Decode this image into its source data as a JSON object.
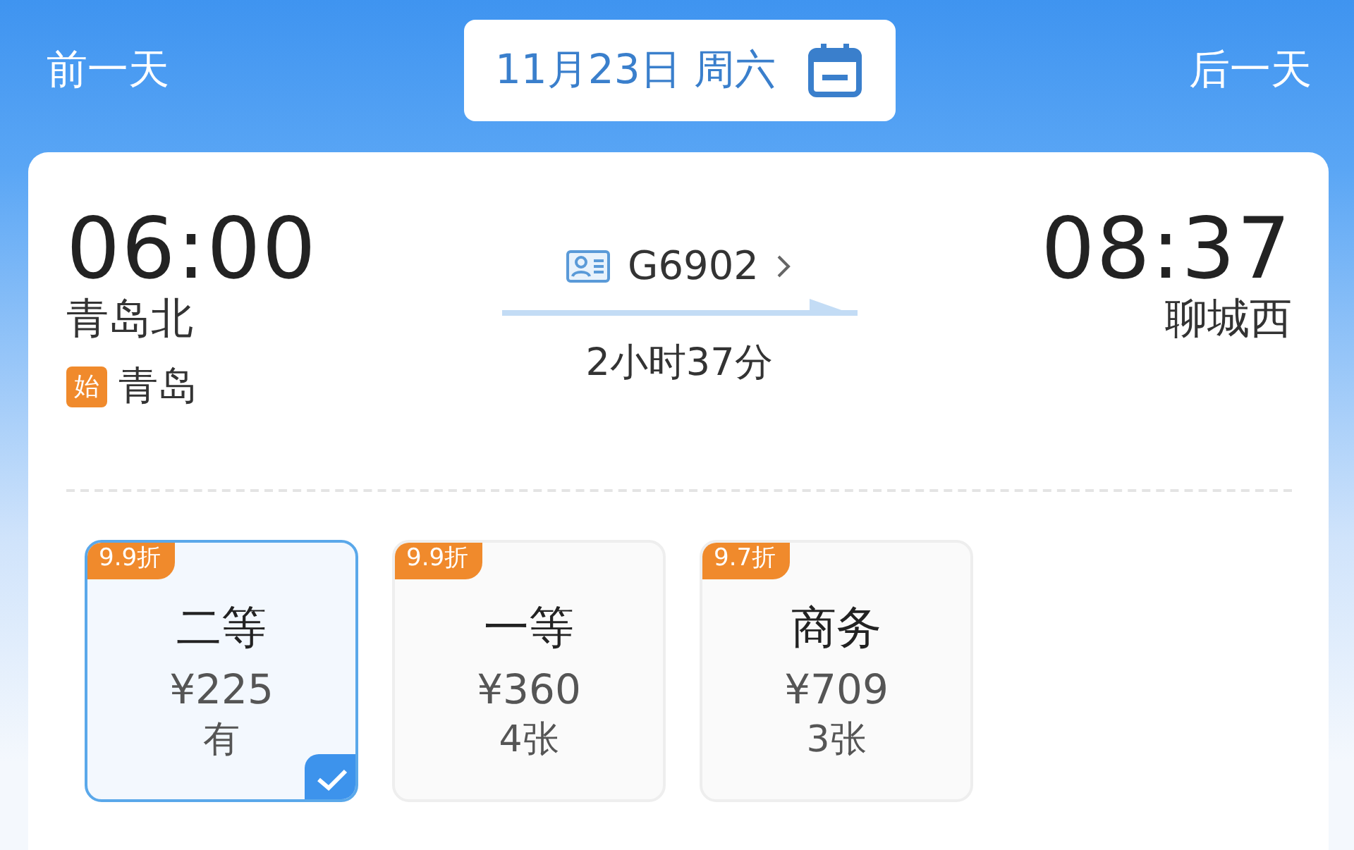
{
  "header": {
    "prev_day": "前一天",
    "date": "11月23日 周六",
    "next_day": "后一天"
  },
  "train": {
    "depart_time": "06:00",
    "depart_station": "青岛北",
    "origin_badge": "始",
    "origin_city": "青岛",
    "train_number": "G6902",
    "duration": "2小时37分",
    "arrive_time": "08:37",
    "arrive_station": "聊城西"
  },
  "seats": [
    {
      "discount": "9.9折",
      "class": "二等",
      "price": "¥225",
      "availability": "有",
      "selected": true
    },
    {
      "discount": "9.9折",
      "class": "一等",
      "price": "¥360",
      "availability": "4张",
      "selected": false
    },
    {
      "discount": "9.7折",
      "class": "商务",
      "price": "¥709",
      "availability": "3张",
      "selected": false
    }
  ]
}
